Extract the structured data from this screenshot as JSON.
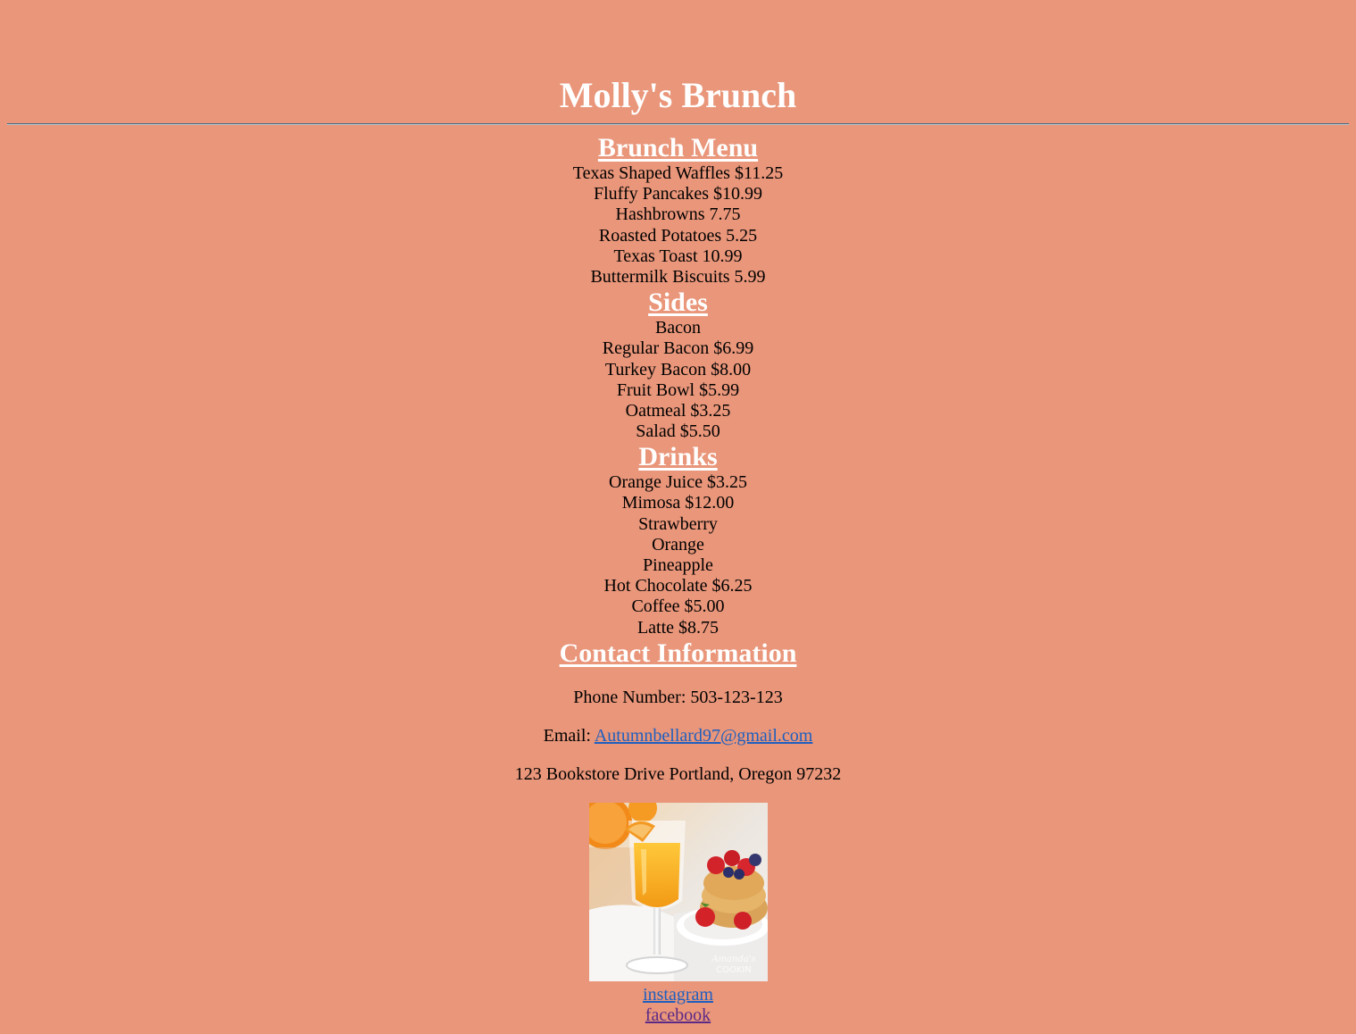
{
  "header": {
    "title": "Molly's Brunch"
  },
  "brunch_menu": {
    "heading": "Brunch Menu",
    "items": [
      "Texas Shaped Waffles $11.25",
      "Fluffy Pancakes $10.99",
      "Hashbrowns 7.75",
      "Roasted Potatoes 5.25",
      "Texas Toast 10.99",
      "Buttermilk Biscuits 5.99"
    ]
  },
  "sides": {
    "heading": "Sides",
    "items": [
      "Bacon",
      "Regular Bacon $6.99",
      "Turkey Bacon $8.00",
      "Fruit Bowl $5.99",
      "Oatmeal $3.25",
      "Salad $5.50"
    ]
  },
  "drinks": {
    "heading": "Drinks",
    "items": [
      "Orange Juice $3.25",
      "Mimosa $12.00",
      "Strawberry",
      "Orange",
      "Pineapple",
      "Hot Chocolate $6.25",
      "Coffee $5.00",
      "Latte $8.75"
    ]
  },
  "contact": {
    "heading": "Contact Information",
    "phone": "Phone Number: 503-123-123",
    "email_label": "Email: ",
    "email": "Autumnbellard97@gmail.com",
    "address": "123 Bookstore Drive Portland, Oregon 97232"
  },
  "photo": {
    "icon": "mimosa-waffle-photo",
    "watermark": "Amanda's COOKIN"
  },
  "social": {
    "instagram": "instagram",
    "facebook": "facebook"
  },
  "colors": {
    "background": "#e9967a",
    "heading": "#ffffff",
    "link": "#1f5fbf",
    "visited_link": "#5b2a86"
  }
}
